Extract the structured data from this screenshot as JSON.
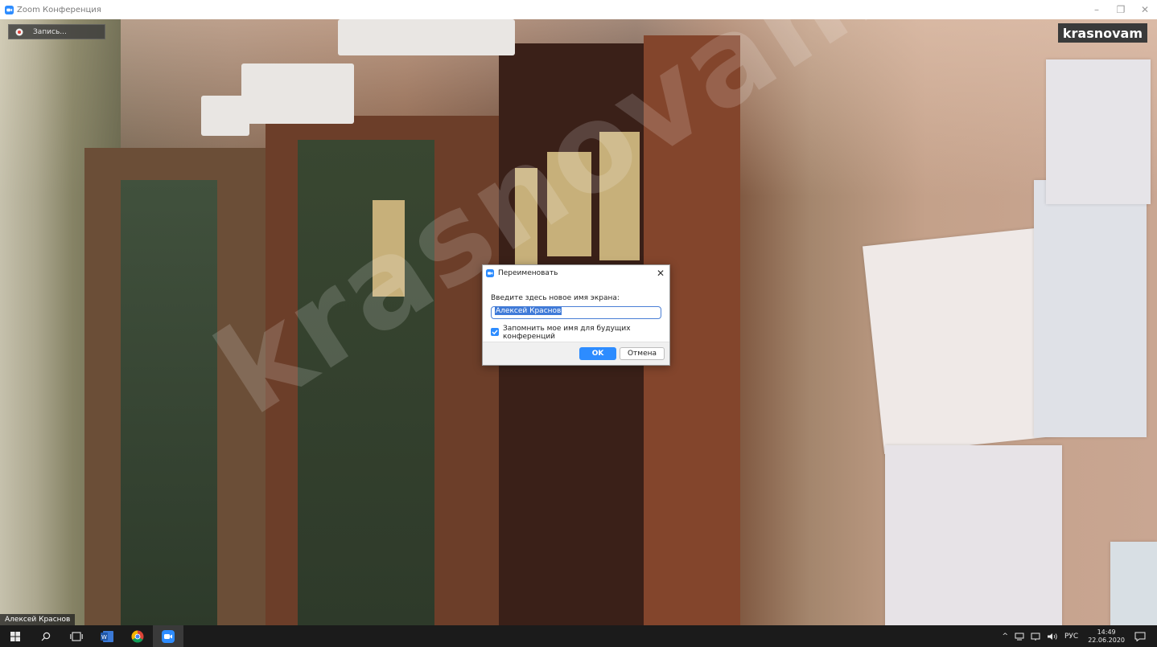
{
  "window": {
    "title": "Zoom Конференция",
    "controls": [
      "–",
      "❐",
      "✕"
    ]
  },
  "video": {
    "recording_label": "Запись...",
    "brand_badge": "krasnovam",
    "watermark": "krasnovam",
    "participant_name": "Алексей Краснов"
  },
  "dialog": {
    "title": "Переименовать",
    "close_glyph": "✕",
    "prompt": "Введите здесь новое имя экрана:",
    "name_value": "Алексей Краснов",
    "remember_label": "Запомнить мое имя для будущих конференций",
    "remember_checked": true,
    "ok_label": "OK",
    "cancel_label": "Отмена"
  },
  "taskbar": {
    "icons": [
      "windows-start-icon",
      "search-icon",
      "task-view-icon",
      "word-icon",
      "chrome-icon",
      "zoom-icon"
    ],
    "tray": {
      "chevron": "^",
      "language": "РУС",
      "time": "14:49",
      "date": "22.06.2020"
    }
  },
  "colors": {
    "zoom_blue": "#2d8cff",
    "taskbar": "#1b1b1b"
  }
}
